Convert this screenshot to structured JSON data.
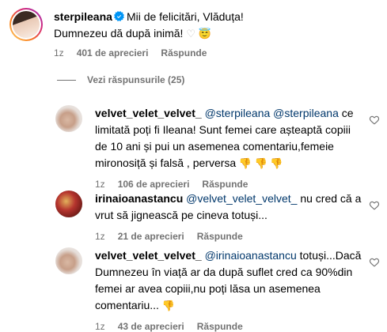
{
  "main_comment": {
    "username": "sterpileana",
    "verified_icon": "verified-badge-icon",
    "text_line1": "Mii de felicitări, Vlăduța!",
    "text_line2": "Dumnezeu dă după inimă!",
    "emojis": "♡ 😇",
    "time": "1z",
    "likes": "401 de aprecieri",
    "reply_label": "Răspunde"
  },
  "view_replies_label": "Vezi răspunsurile (25)",
  "replies": [
    {
      "username": "velvet_velet_velvet_",
      "mentions": "@sterpileana @sterpileana",
      "text": " ce limitată poți fi Ileana! Sunt femei care așteaptă copiii de 10 ani și pui un asemenea comentariu,femeie mironosiță și falsă , perversa",
      "emojis": " 👎 👎 👎",
      "time": "1z",
      "likes": "106 de aprecieri",
      "reply_label": "Răspunde"
    },
    {
      "username": "irinaioanastancu",
      "mentions": "@velvet_velet_velvet_",
      "text": " nu cred că a vrut să jignească pe cineva totuși...",
      "emojis": "",
      "time": "1z",
      "likes": "21 de aprecieri",
      "reply_label": "Răspunde"
    },
    {
      "username": "velvet_velet_velvet_",
      "mentions": "@irinaioanastancu",
      "text": " totuși...Dacă Dumnezeu în viață ar da după suflet cred ca 90%din femei ar avea copiii,nu poți lăsa un asemenea comentariu...",
      "emojis": " 👎",
      "time": "1z",
      "likes": "43 de aprecieri",
      "reply_label": "Răspunde"
    }
  ],
  "colors": {
    "mention": "#00376b",
    "meta": "#737373",
    "verified": "#0095f6",
    "story_ring_start": "#feda75",
    "story_ring_end": "#d62976"
  }
}
